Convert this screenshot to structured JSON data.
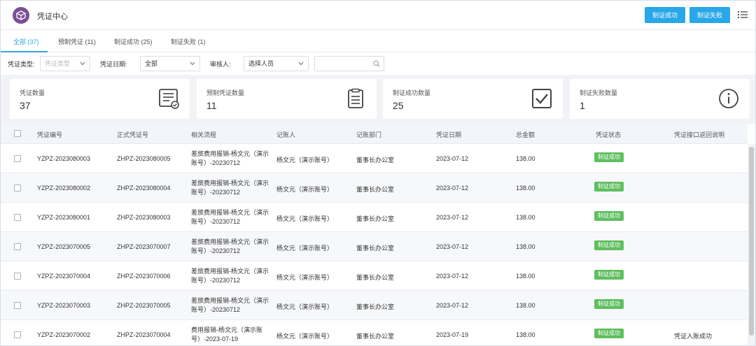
{
  "header": {
    "title": "凭证中心",
    "btn_success": "制证成功",
    "btn_fail": "制证失败"
  },
  "tabs": [
    {
      "label": "全部 (37)"
    },
    {
      "label": "预制凭证 (11)"
    },
    {
      "label": "制证成功 (25)"
    },
    {
      "label": "制证失败 (1)"
    }
  ],
  "filters": {
    "type_label": "凭证类型:",
    "type_placeholder": "凭证类型",
    "date_label": "凭证日期:",
    "date_value": "全部",
    "reviewer_label": "审核人:",
    "reviewer_value": "选择人员"
  },
  "stats": [
    {
      "label": "凭证数量",
      "value": "37",
      "icon": "voucher-doc-icon"
    },
    {
      "label": "预制凭证数量",
      "value": "11",
      "icon": "clipboard-icon"
    },
    {
      "label": "制证成功数量",
      "value": "25",
      "icon": "checkbox-icon"
    },
    {
      "label": "制证失败数量",
      "value": "1",
      "icon": "info-circle-icon"
    }
  ],
  "table": {
    "headers": [
      "凭证编号",
      "正式凭证号",
      "相关流程",
      "记账人",
      "记账部门",
      "凭证日期",
      "总金额",
      "凭证状态",
      "凭证接口返回说明"
    ],
    "rows": [
      {
        "no": "YZPZ-2023080003",
        "formal": "ZHPZ-2023080005",
        "flow1": "差旅费用报销-杨文元（演示",
        "flow2": "账号）-20230712",
        "person": "杨文元（演示账号）",
        "dept": "董事长办公室",
        "date": "2023-07-12",
        "amount": "138.00",
        "status": "制证成功",
        "note": ""
      },
      {
        "no": "YZPZ-2023080002",
        "formal": "ZHPZ-2023080004",
        "flow1": "差旅费用报销-杨文元（演示",
        "flow2": "账号）-20230712",
        "person": "杨文元（演示账号）",
        "dept": "董事长办公室",
        "date": "2023-07-12",
        "amount": "138.00",
        "status": "制证成功",
        "note": ""
      },
      {
        "no": "YZPZ-2023080001",
        "formal": "ZHPZ-2023080003",
        "flow1": "差旅费用报销-杨文元（演示",
        "flow2": "账号）-20230712",
        "person": "杨文元（演示账号）",
        "dept": "董事长办公室",
        "date": "2023-07-12",
        "amount": "138.00",
        "status": "制证成功",
        "note": ""
      },
      {
        "no": "YZPZ-2023070005",
        "formal": "ZHPZ-2023070007",
        "flow1": "差旅费用报销-杨文元（演示",
        "flow2": "账号）-20230712",
        "person": "杨文元（演示账号）",
        "dept": "董事长办公室",
        "date": "2023-07-12",
        "amount": "138.00",
        "status": "制证成功",
        "note": ""
      },
      {
        "no": "YZPZ-2023070004",
        "formal": "ZHPZ-2023070006",
        "flow1": "差旅费用报销-杨文元（演示",
        "flow2": "账号）-20230712",
        "person": "杨文元（演示账号）",
        "dept": "董事长办公室",
        "date": "2023-07-12",
        "amount": "138.00",
        "status": "制证成功",
        "note": ""
      },
      {
        "no": "YZPZ-2023070003",
        "formal": "ZHPZ-2023070005",
        "flow1": "差旅费用报销-杨文元（演示",
        "flow2": "账号）-20230712",
        "person": "杨文元（演示账号）",
        "dept": "董事长办公室",
        "date": "2023-07-12",
        "amount": "138.00",
        "status": "制证成功",
        "note": ""
      },
      {
        "no": "YZPZ-2023070002",
        "formal": "ZHPZ-2023070004",
        "flow1": "费用报销-杨文元（演示账",
        "flow2": "号）-2023-07-19",
        "person": "杨文元（演示账号）",
        "dept": "董事长办公室",
        "date": "2023-07-19",
        "amount": "138.00",
        "status": "制证成功",
        "note": "凭证入账成功"
      }
    ]
  },
  "colors": {
    "accent": "#29a7e8",
    "success": "#5fbf5f",
    "logo": "#7b4e96"
  }
}
